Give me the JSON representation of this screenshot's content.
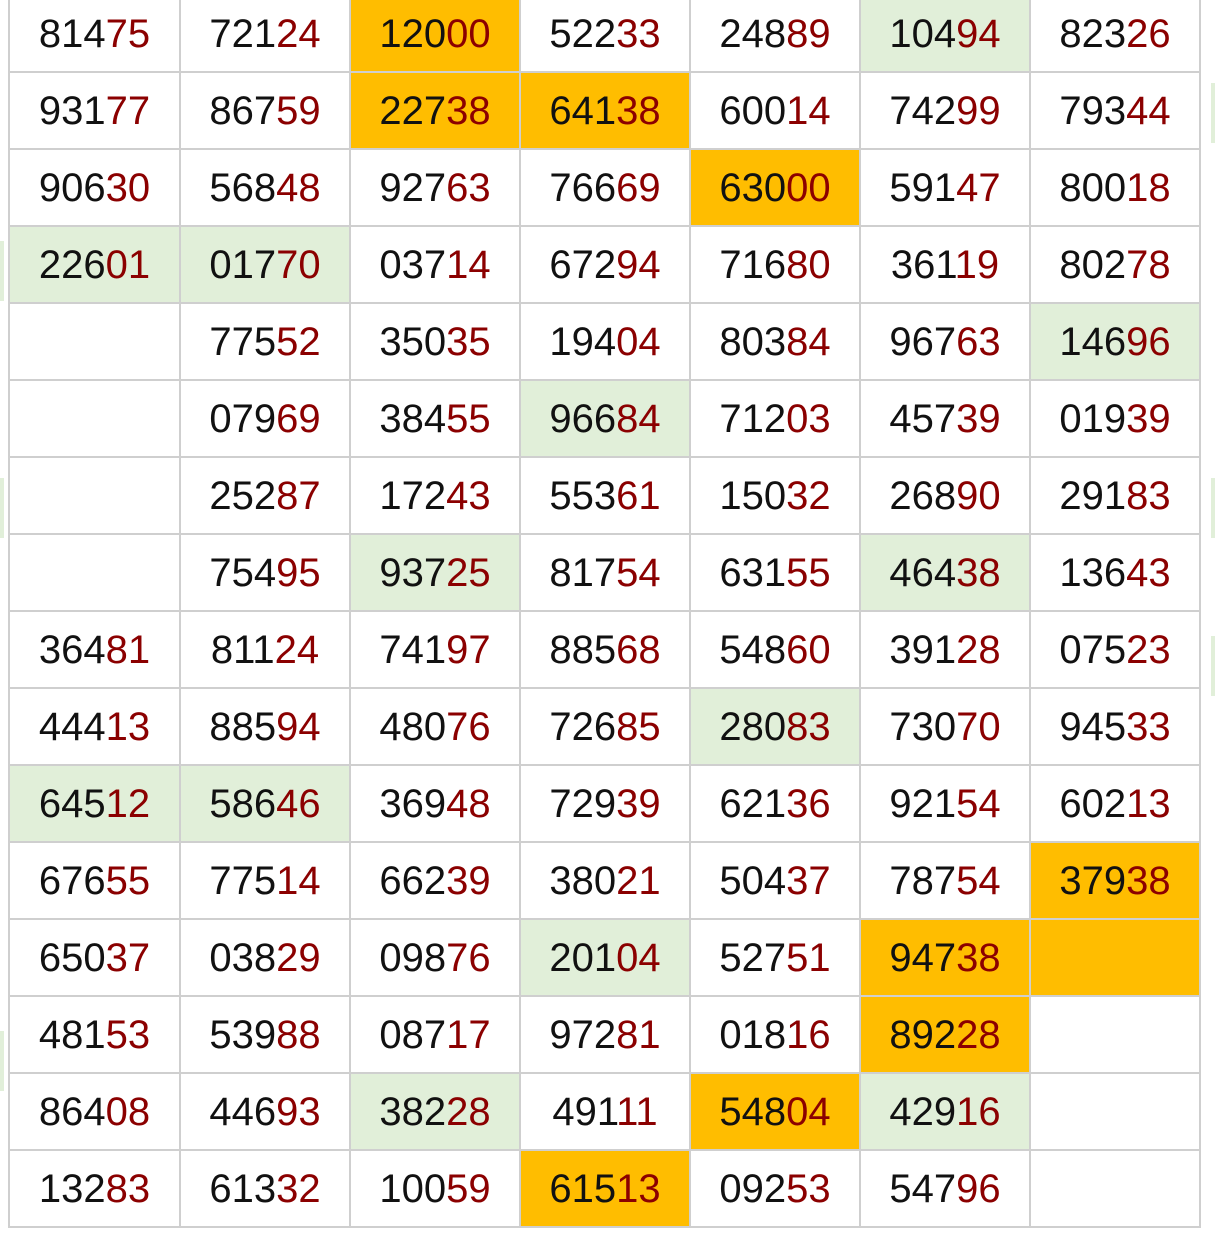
{
  "grid": {
    "rows": [
      [
        [
          "814",
          "75",
          ""
        ],
        [
          "721",
          "24",
          ""
        ],
        [
          "120",
          "00",
          "orange"
        ],
        [
          "522",
          "33",
          ""
        ],
        [
          "248",
          "89",
          ""
        ],
        [
          "104",
          "94",
          "green"
        ],
        [
          "823",
          "26",
          ""
        ]
      ],
      [
        [
          "931",
          "77",
          ""
        ],
        [
          "867",
          "59",
          ""
        ],
        [
          "227",
          "38",
          "orange"
        ],
        [
          "641",
          "38",
          "orange"
        ],
        [
          "600",
          "14",
          ""
        ],
        [
          "742",
          "99",
          ""
        ],
        [
          "793",
          "44",
          ""
        ]
      ],
      [
        [
          "906",
          "30",
          ""
        ],
        [
          "568",
          "48",
          ""
        ],
        [
          "927",
          "63",
          ""
        ],
        [
          "766",
          "69",
          ""
        ],
        [
          "630",
          "00",
          "orange"
        ],
        [
          "591",
          "47",
          ""
        ],
        [
          "800",
          "18",
          ""
        ]
      ],
      [
        [
          "226",
          "01",
          "green"
        ],
        [
          "017",
          "70",
          "green"
        ],
        [
          "037",
          "14",
          ""
        ],
        [
          "672",
          "94",
          ""
        ],
        [
          "716",
          "80",
          ""
        ],
        [
          "361",
          "19",
          ""
        ],
        [
          "802",
          "78",
          ""
        ]
      ],
      [
        [
          "",
          "",
          ""
        ],
        [
          "775",
          "52",
          ""
        ],
        [
          "350",
          "35",
          ""
        ],
        [
          "194",
          "04",
          ""
        ],
        [
          "803",
          "84",
          ""
        ],
        [
          "967",
          "63",
          ""
        ],
        [
          "146",
          "96",
          "green"
        ]
      ],
      [
        [
          "",
          "",
          ""
        ],
        [
          "079",
          "69",
          ""
        ],
        [
          "384",
          "55",
          ""
        ],
        [
          "966",
          "84",
          "green"
        ],
        [
          "712",
          "03",
          ""
        ],
        [
          "457",
          "39",
          ""
        ],
        [
          "019",
          "39",
          ""
        ]
      ],
      [
        [
          "",
          "",
          ""
        ],
        [
          "252",
          "87",
          ""
        ],
        [
          "172",
          "43",
          ""
        ],
        [
          "553",
          "61",
          ""
        ],
        [
          "150",
          "32",
          ""
        ],
        [
          "268",
          "90",
          ""
        ],
        [
          "291",
          "83",
          ""
        ]
      ],
      [
        [
          "",
          "",
          ""
        ],
        [
          "754",
          "95",
          ""
        ],
        [
          "937",
          "25",
          "green"
        ],
        [
          "817",
          "54",
          ""
        ],
        [
          "631",
          "55",
          ""
        ],
        [
          "464",
          "38",
          "green"
        ],
        [
          "136",
          "43",
          ""
        ]
      ],
      [
        [
          "364",
          "81",
          ""
        ],
        [
          "811",
          "24",
          ""
        ],
        [
          "741",
          "97",
          ""
        ],
        [
          "885",
          "68",
          ""
        ],
        [
          "548",
          "60",
          ""
        ],
        [
          "391",
          "28",
          ""
        ],
        [
          "075",
          "23",
          ""
        ]
      ],
      [
        [
          "444",
          "13",
          ""
        ],
        [
          "885",
          "94",
          ""
        ],
        [
          "480",
          "76",
          ""
        ],
        [
          "726",
          "85",
          ""
        ],
        [
          "280",
          "83",
          "green"
        ],
        [
          "730",
          "70",
          ""
        ],
        [
          "945",
          "33",
          ""
        ]
      ],
      [
        [
          "645",
          "12",
          "green"
        ],
        [
          "586",
          "46",
          "green"
        ],
        [
          "369",
          "48",
          ""
        ],
        [
          "729",
          "39",
          ""
        ],
        [
          "621",
          "36",
          ""
        ],
        [
          "921",
          "54",
          ""
        ],
        [
          "602",
          "13",
          ""
        ]
      ],
      [
        [
          "676",
          "55",
          ""
        ],
        [
          "775",
          "14",
          ""
        ],
        [
          "662",
          "39",
          ""
        ],
        [
          "380",
          "21",
          ""
        ],
        [
          "504",
          "37",
          ""
        ],
        [
          "787",
          "54",
          ""
        ],
        [
          "379",
          "38",
          "orange"
        ]
      ],
      [
        [
          "650",
          "37",
          ""
        ],
        [
          "038",
          "29",
          ""
        ],
        [
          "098",
          "76",
          ""
        ],
        [
          "201",
          "04",
          "green"
        ],
        [
          "527",
          "51",
          ""
        ],
        [
          "947",
          "38",
          "orange"
        ],
        [
          "",
          "",
          "orange"
        ]
      ],
      [
        [
          "481",
          "53",
          ""
        ],
        [
          "539",
          "88",
          ""
        ],
        [
          "087",
          "17",
          ""
        ],
        [
          "972",
          "81",
          ""
        ],
        [
          "018",
          "16",
          ""
        ],
        [
          "892",
          "28",
          "orange"
        ],
        [
          "",
          "",
          ""
        ]
      ],
      [
        [
          "864",
          "08",
          ""
        ],
        [
          "446",
          "93",
          ""
        ],
        [
          "382",
          "28",
          "green"
        ],
        [
          "491",
          "11",
          ""
        ],
        [
          "548",
          "04",
          "orange"
        ],
        [
          "429",
          "16",
          "green"
        ],
        [
          "",
          "",
          ""
        ]
      ],
      [
        [
          "132",
          "83",
          ""
        ],
        [
          "613",
          "32",
          ""
        ],
        [
          "100",
          "59",
          ""
        ],
        [
          "615",
          "13",
          "orange"
        ],
        [
          "092",
          "53",
          ""
        ],
        [
          "547",
          "96",
          ""
        ],
        [
          "",
          "",
          ""
        ]
      ]
    ]
  },
  "colors": {
    "highlight_orange": "#ffbd00",
    "highlight_green": "#e1efd9",
    "prefix_text": "#111111",
    "suffix_text": "#8b0000",
    "grid_line": "#cfcfcf"
  }
}
